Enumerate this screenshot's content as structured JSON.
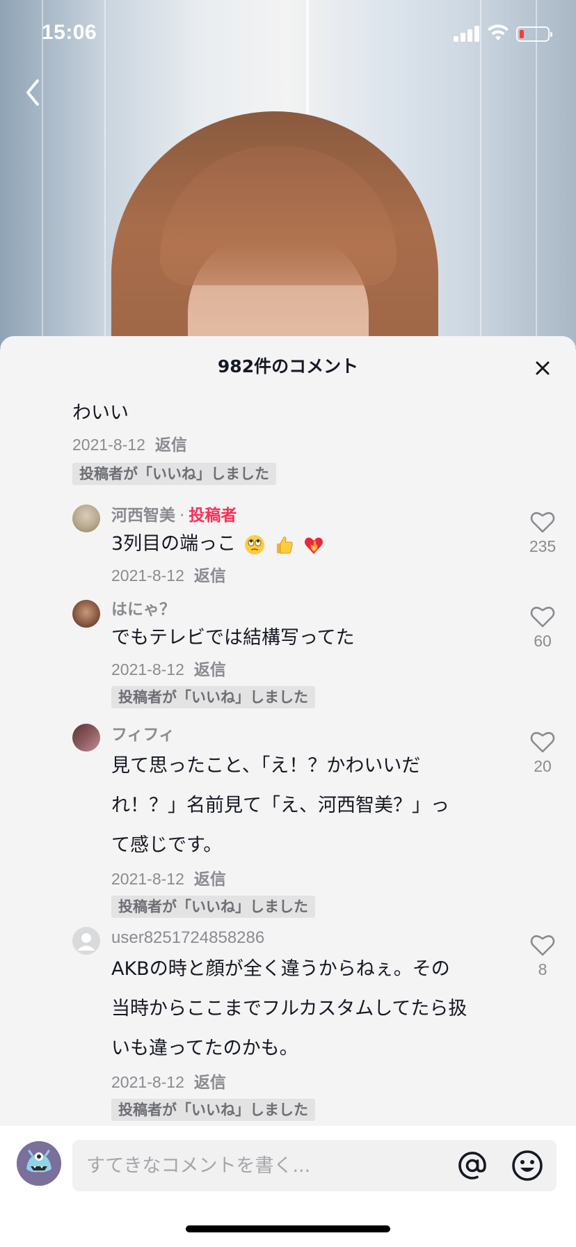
{
  "status_bar": {
    "time": "15:06"
  },
  "sheet": {
    "title": "982件のコメント"
  },
  "comments": [
    {
      "text": "わいい",
      "date": "2021-8-12",
      "reply_label": "返信",
      "liked_tag": "投稿者が「いいね」しました"
    },
    {
      "username": "河西智美",
      "author_tag": "投稿者",
      "separator": "·",
      "text": "3列目の端っこ",
      "emoji_icons": [
        "rolling-eyes-icon",
        "thumbs-up-icon",
        "heart-on-fire-icon"
      ],
      "date": "2021-8-12",
      "reply_label": "返信",
      "likes": "235"
    },
    {
      "username": "はにゃ？",
      "text": "でもテレビでは結構写ってた",
      "date": "2021-8-12",
      "reply_label": "返信",
      "liked_tag": "投稿者が「いいね」しました",
      "likes": "60"
    },
    {
      "username": "フィフィ",
      "text_lines": [
        "見て思ったこと、「え！？かわいいだ",
        "れ！？」名前見て「え、河西智美？」っ",
        "て感じです。"
      ],
      "date": "2021-8-12",
      "reply_label": "返信",
      "liked_tag": "投稿者が「いいね」しました",
      "likes": "20"
    },
    {
      "username": "user8251724858286",
      "text_lines": [
        "AKBの時と顔が全く違うからねぇ。その",
        "当時からここまでフルカスタムしてたら扱",
        "いも違ってたのかも。"
      ],
      "date": "2021-8-12",
      "reply_label": "返信",
      "liked_tag": "投稿者が「いいね」しました",
      "likes": "8"
    }
  ],
  "input": {
    "placeholder": "すてきなコメントを書く..."
  },
  "colors": {
    "author_accent": "#fe2c55",
    "sheet_bg": "#f4f4f4",
    "muted_text": "#8a8b91"
  }
}
